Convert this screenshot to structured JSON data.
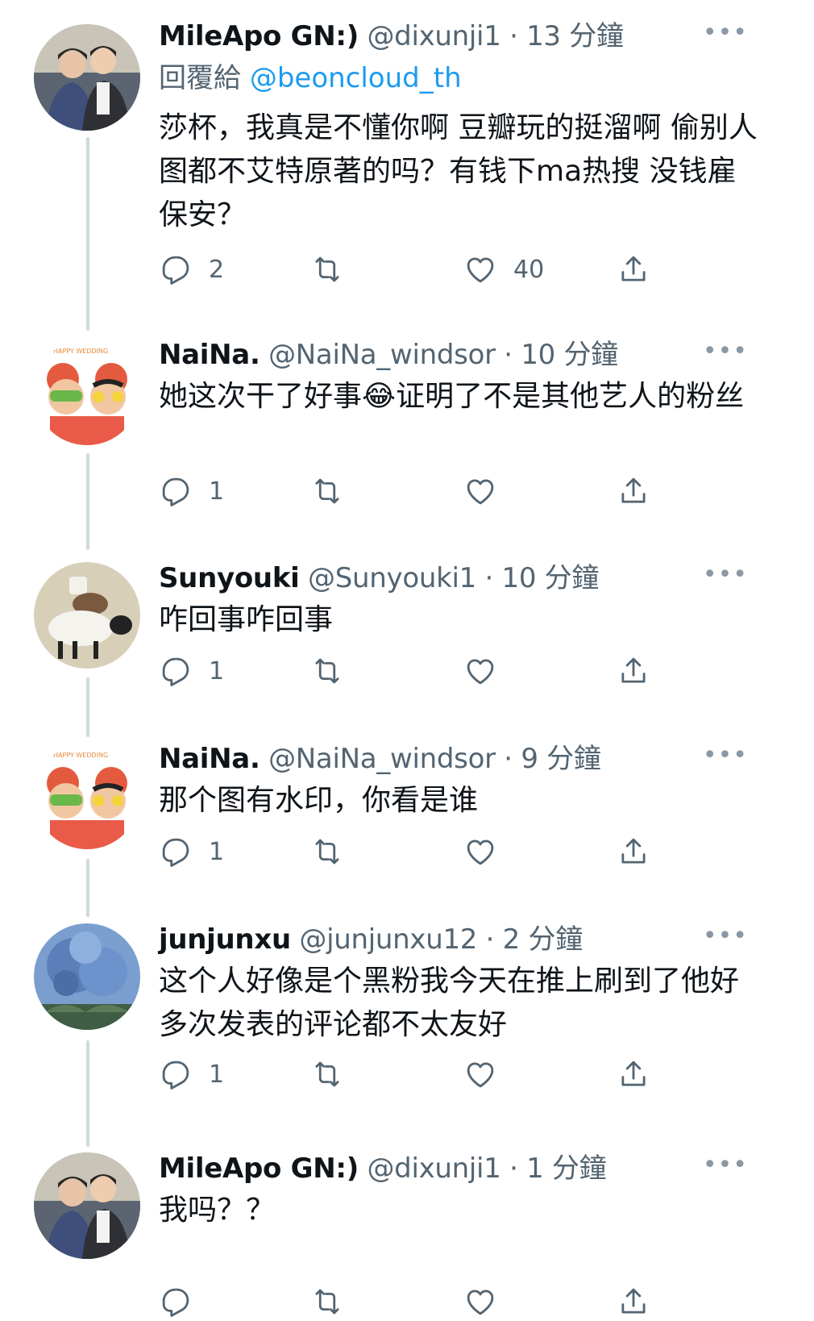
{
  "tweets": [
    {
      "name": "MileApo GN:)",
      "handle": "@dixunji1",
      "dot": "·",
      "time": "13 分鐘",
      "reply_to_prefix": "回覆給",
      "reply_to_handle": "@beoncloud_th",
      "text": "莎杯，我真是不懂你啊 豆瓣玩的挺溜啊 偷别人图都不艾特原著的吗？有钱下ma热搜 没钱雇保安？",
      "replies": "2",
      "retweets": "",
      "likes": "40",
      "avatar": "photo-two-men"
    },
    {
      "name": "NaiNa.",
      "handle": "@NaiNa_windsor",
      "dot": "·",
      "time": "10 分鐘",
      "text": "她这次干了好事😂证明了不是其他艺人的粉丝",
      "replies": "1",
      "retweets": "",
      "likes": "",
      "avatar": "cartoon-couple"
    },
    {
      "name": "Sunyouki",
      "handle": "@Sunyouki1",
      "dot": "·",
      "time": "10 分鐘",
      "text": "咋回事咋回事",
      "replies": "1",
      "retweets": "",
      "likes": "",
      "avatar": "sheep-cartoon"
    },
    {
      "name": "NaiNa.",
      "handle": "@NaiNa_windsor",
      "dot": "·",
      "time": "9 分鐘",
      "text": "那个图有水印，你看是谁",
      "replies": "1",
      "retweets": "",
      "likes": "",
      "avatar": "cartoon-couple"
    },
    {
      "name": "junjunxu",
      "handle": "@junjunxu12",
      "dot": "·",
      "time": "2 分鐘",
      "text": "这个人好像是个黑粉我今天在推上刷到了他好多次发表的评论都不太友好",
      "replies": "1",
      "retweets": "",
      "likes": "",
      "avatar": "blue-flowers"
    },
    {
      "name": "MileApo GN:)",
      "handle": "@dixunji1",
      "dot": "·",
      "time": "1 分鐘",
      "text": "我吗？？",
      "replies": "",
      "retweets": "",
      "likes": "",
      "avatar": "photo-two-men"
    }
  ],
  "icons": {
    "more": "more-icon",
    "reply": "reply-icon",
    "retweet": "retweet-icon",
    "like": "like-icon",
    "share": "share-icon"
  },
  "colors": {
    "text": "#0f1419",
    "secondary": "#536471",
    "accent": "#1d9bf0",
    "thread_line": "#cfd9de"
  },
  "more_glyph": "•••"
}
